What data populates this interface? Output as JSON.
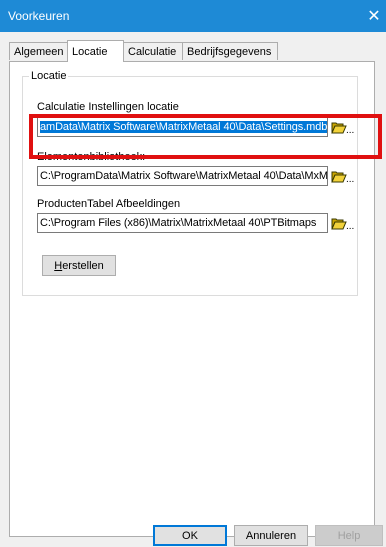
{
  "window": {
    "title": "Voorkeuren",
    "close_glyph": "✕"
  },
  "tabs": [
    {
      "label": "Algemeen",
      "active": false
    },
    {
      "label": "Locatie",
      "active": true
    },
    {
      "label": "Calculatie",
      "active": false
    },
    {
      "label": "Bedrijfsgegevens",
      "active": false
    }
  ],
  "group": {
    "legend": "Locatie",
    "fields": [
      {
        "label": "Calculatie Instellingen locatie",
        "value": "amData\\Matrix Software\\MatrixMetaal 40\\Data\\Settings.mdb",
        "selected": true
      },
      {
        "label": "Elementenbibliotheek:",
        "value": "C:\\ProgramData\\Matrix Software\\MatrixMetaal 40\\Data\\MxM",
        "selected": false
      },
      {
        "label": "ProductenTabel Afbeeldingen",
        "value": "C:\\Program Files (x86)\\Matrix\\MatrixMetaal 40\\PTBitmaps",
        "selected": false
      }
    ],
    "browse_dots": "...",
    "reset_button": {
      "accel": "H",
      "rest": "erstellen"
    }
  },
  "buttons": {
    "ok": "OK",
    "cancel": "Annuleren",
    "help": "Help"
  },
  "icons": {
    "close": "close-icon",
    "browse": "open-folder-icon"
  },
  "colors": {
    "titlebar": "#1e8ad6",
    "selection": "#0078d7",
    "highlight": "#e01010"
  }
}
